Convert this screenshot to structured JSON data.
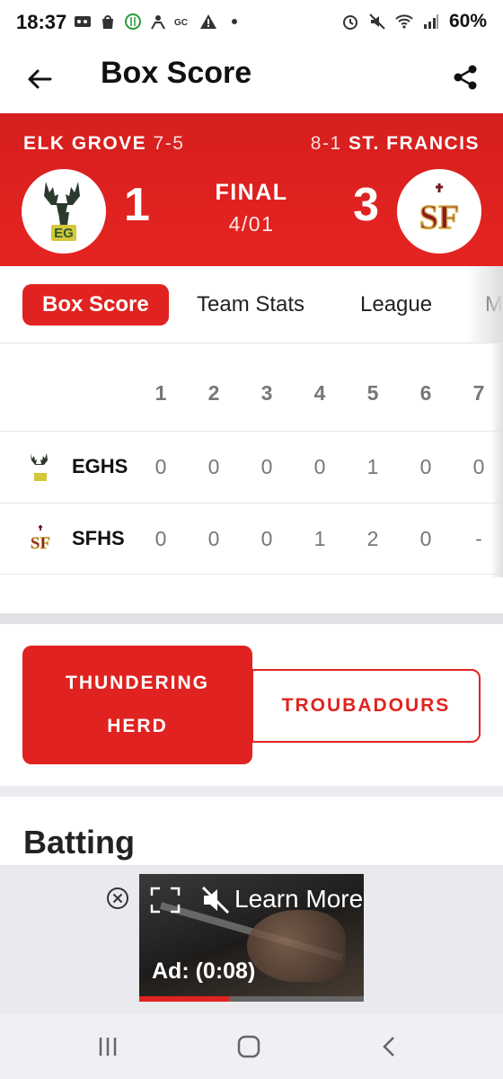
{
  "status_bar": {
    "time": "18:37",
    "battery": "60%",
    "left_icons": [
      "voicemail-icon",
      "bag-icon",
      "food-icon",
      "person-icon",
      "gc-icon",
      "warning-icon"
    ],
    "right_icons": [
      "alarm-icon",
      "mute-icon",
      "wifi-icon",
      "signal-icon"
    ]
  },
  "app_bar": {
    "title": "Box Score",
    "back_icon": "arrow-left-icon",
    "share_icon": "share-icon"
  },
  "game": {
    "home_team": {
      "name": "ELK GROVE",
      "record": "7-5",
      "score": "1",
      "logo_text": "EG"
    },
    "away_team": {
      "name": "ST. FRANCIS",
      "record": "8-1",
      "score": "3",
      "logo_text": "SF"
    },
    "status": "FINAL",
    "date": "4/01",
    "accent_color": "#e02320"
  },
  "tabs": [
    {
      "label": "Box Score",
      "active": true
    },
    {
      "label": "Team Stats",
      "active": false
    },
    {
      "label": "League",
      "active": false
    },
    {
      "label": "M",
      "active": false
    }
  ],
  "linescore": {
    "innings": [
      "1",
      "2",
      "3",
      "4",
      "5",
      "6",
      "7"
    ],
    "rows": [
      {
        "team": "EGHS",
        "runs": [
          "0",
          "0",
          "0",
          "0",
          "1",
          "0",
          "0"
        ]
      },
      {
        "team": "SFHS",
        "runs": [
          "0",
          "0",
          "0",
          "1",
          "2",
          "0",
          "-"
        ]
      }
    ]
  },
  "team_toggle": {
    "left": "THUNDERING HERD",
    "right": "TROUBADOURS"
  },
  "section": {
    "batting_title": "Batting"
  },
  "ad": {
    "learn_more": "Learn More",
    "timer": "Ad: (0:08)",
    "progress": 0.4
  }
}
